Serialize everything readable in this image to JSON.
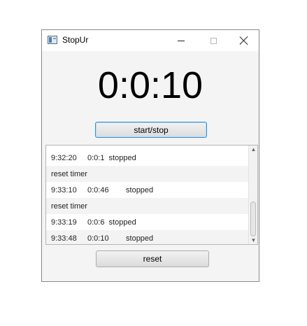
{
  "window": {
    "title": "StopUr",
    "controls": {
      "minimize_icon": "minimize-icon",
      "maximize_icon": "maximize-icon",
      "close_icon": "close-icon"
    }
  },
  "timer": {
    "display": "0:0:10"
  },
  "buttons": {
    "start_stop": "start/stop",
    "reset": "reset"
  },
  "log": {
    "entries": [
      "9:32:20     0:0:1  stopped",
      "reset timer",
      "9:33:10     0:0:46        stopped",
      "reset timer",
      "9:33:19     0:0:6  stopped",
      "9:33:48     0:0:10        stopped"
    ]
  },
  "colors": {
    "focus_border": "#2e8fd8",
    "window_bg": "#f4f4f4"
  }
}
